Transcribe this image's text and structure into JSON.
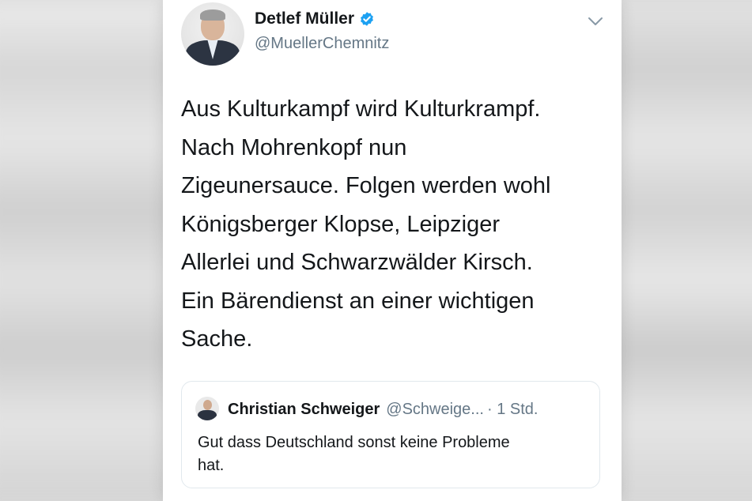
{
  "tweet": {
    "author_name": "Detlef Müller",
    "author_handle": "@MuellerChemnitz",
    "text_lines": [
      "Aus Kulturkampf wird Kulturkrampf.",
      "Nach Mohrenkopf nun",
      "Zigeunersauce. Folgen werden wohl",
      "Königsberger Klopse, Leipziger",
      "Allerlei und Schwarzwälder Kirsch.",
      "Ein Bärendienst an einer wichtigen",
      "Sache."
    ],
    "verified_icon": "verified-badge-icon",
    "menu_icon": "chevron-down-icon"
  },
  "quoted_tweet": {
    "author_name": "Christian Schweiger",
    "author_handle": "@Schweige...",
    "time": "· 1 Std.",
    "text_lines": [
      "Gut dass Deutschland sonst keine Probleme",
      "hat."
    ]
  },
  "colors": {
    "verified_blue": "#1da1f2",
    "secondary_text": "#657786",
    "primary_text": "#14171a",
    "border": "#e1e8ed"
  }
}
